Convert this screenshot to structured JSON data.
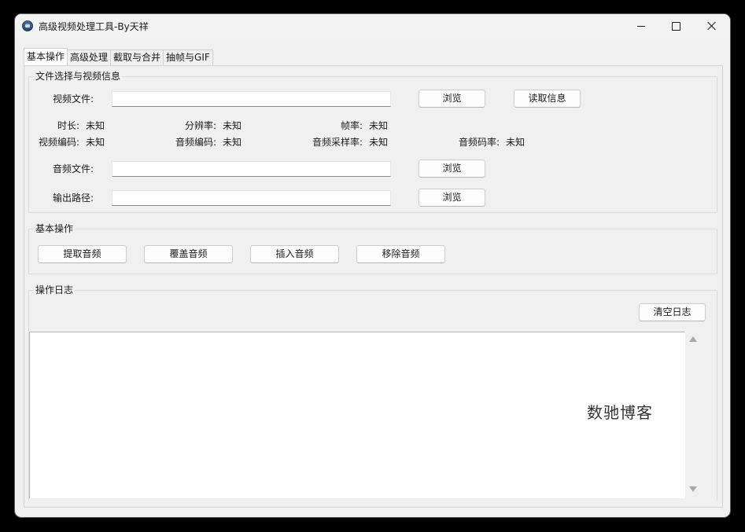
{
  "window": {
    "title": "高级视频处理工具-By天祥",
    "controls": {
      "minimize": "minimize-icon",
      "maximize": "maximize-icon",
      "close": "close-icon"
    }
  },
  "tabs": [
    {
      "label": "基本操作",
      "active": true
    },
    {
      "label": "高级处理",
      "active": false
    },
    {
      "label": "截取与合并",
      "active": false
    },
    {
      "label": "抽帧与GIF",
      "active": false
    }
  ],
  "file_section": {
    "title": "文件选择与视频信息",
    "video_file_label": "视频文件:",
    "video_file_value": "",
    "browse_label": "浏览",
    "read_info_label": "读取信息",
    "info": {
      "duration_label": "时长:",
      "duration_value": "未知",
      "resolution_label": "分辨率:",
      "resolution_value": "未知",
      "framerate_label": "帧率:",
      "framerate_value": "未知",
      "video_codec_label": "视频编码:",
      "video_codec_value": "未知",
      "audio_codec_label": "音频编码:",
      "audio_codec_value": "未知",
      "sample_rate_label": "音频采样率:",
      "sample_rate_value": "未知",
      "audio_bitrate_label": "音频码率:",
      "audio_bitrate_value": "未知"
    },
    "audio_file_label": "音频文件:",
    "audio_file_value": "",
    "output_path_label": "输出路径:",
    "output_path_value": ""
  },
  "basic_ops": {
    "title": "基本操作",
    "buttons": [
      "提取音频",
      "覆盖音频",
      "插入音频",
      "移除音频"
    ]
  },
  "log_section": {
    "title": "操作日志",
    "clear_label": "清空日志",
    "watermark": "数驰博客"
  },
  "colors": {
    "window_bg": "#f0f0f0",
    "field_bg": "#ffffff",
    "backdrop": "#000000"
  }
}
